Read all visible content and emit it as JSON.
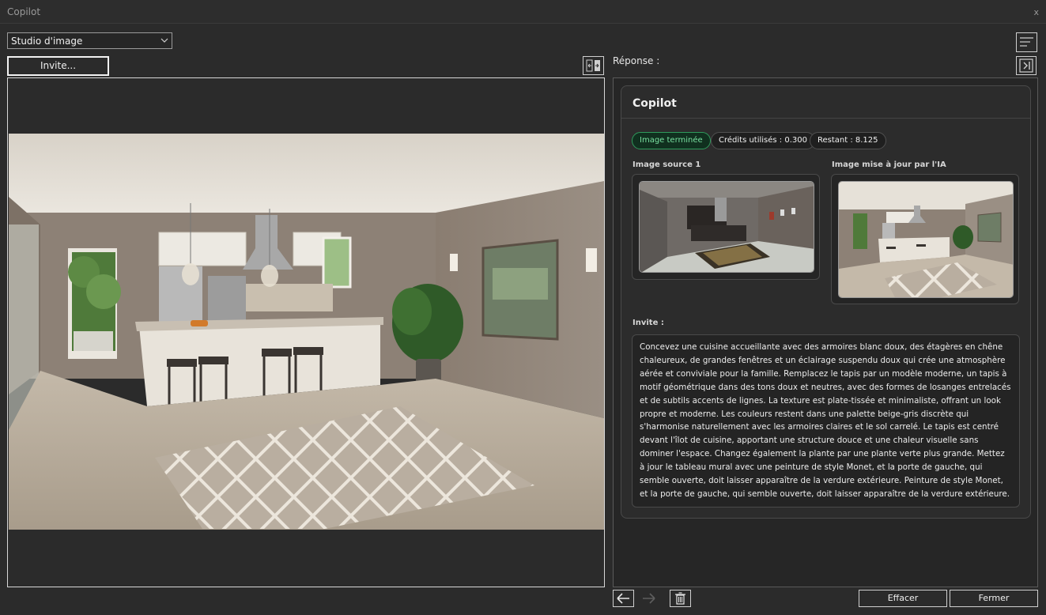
{
  "window": {
    "title": "Copilot",
    "close_glyph": "x"
  },
  "toolbar": {
    "mode_select": {
      "value": "Studio d'image",
      "icon": "chevron-down-icon"
    },
    "invite_button": "Invite...",
    "swap_icon": "swap-panels-icon"
  },
  "response": {
    "label": "Réponse :",
    "card": {
      "title": "Copilot",
      "badges": {
        "status": "Image terminée",
        "credits_used": "Crédits utilisés : 0.300",
        "remaining": "Restant : 8.125"
      },
      "source_image_label": "Image source 1",
      "updated_image_label": "Image mise à jour par l'IA",
      "prompt_label": "Invite :",
      "prompt_text": "Concevez une cuisine accueillante avec des armoires blanc doux, des étagères en chêne chaleureux, de grandes fenêtres et un éclairage suspendu doux qui crée une atmosphère aérée et conviviale pour la famille. Remplacez le tapis par un modèle moderne, un tapis à motif géométrique dans des tons doux et neutres, avec des formes de losanges entrelacés et de subtils accents de lignes. La texture est plate-tissée et minimaliste, offrant un look propre et moderne. Les couleurs restent dans une palette beige-gris discrète qui s'harmonise naturellement avec les armoires claires et le sol carrelé. Le tapis est centré devant l'îlot de cuisine, apportant une structure douce et une chaleur visuelle sans dominer l'espace. Changez également la plante par une plante verte plus grande. Mettez à jour le tableau mural avec une peinture de style Monet, et la porte de gauche, qui semble ouverte, doit laisser apparaître de la verdure extérieure. Peinture de style Monet, et la porte de gauche, qui semble ouverte, doit laisser apparaître de la verdure extérieure."
    }
  },
  "footer": {
    "clear_button": "Effacer",
    "close_button": "Fermer"
  },
  "colors": {
    "success": "#2f9a5c",
    "background": "#2b2b2b",
    "border": "#cfcfcf"
  }
}
